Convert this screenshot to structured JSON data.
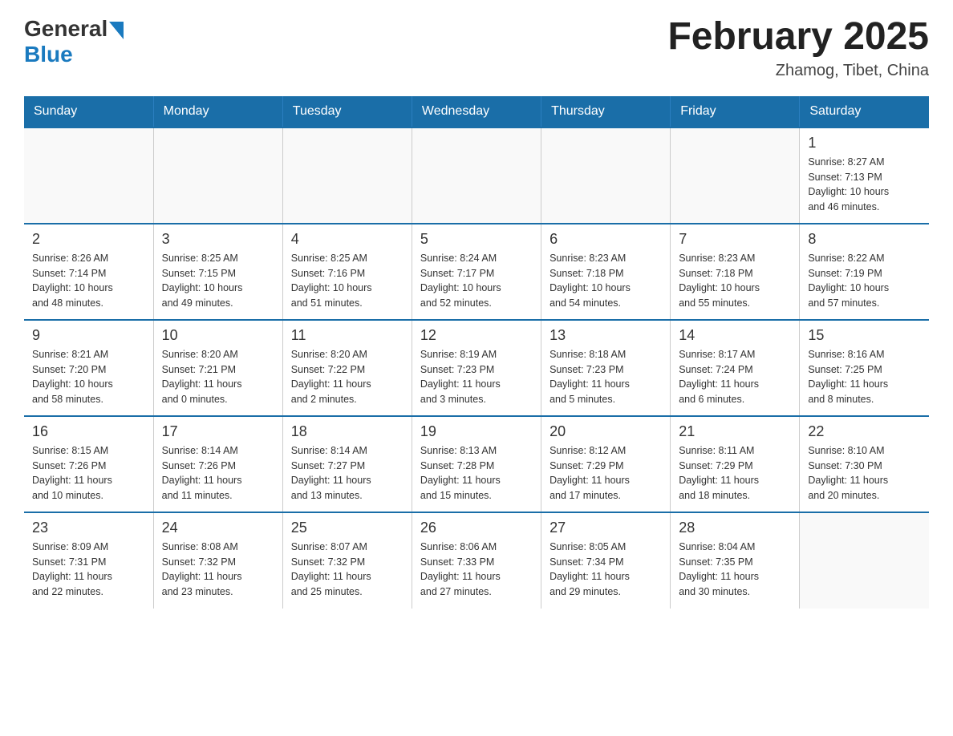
{
  "header": {
    "logo_general": "General",
    "logo_blue": "Blue",
    "month_title": "February 2025",
    "location": "Zhamog, Tibet, China"
  },
  "days_of_week": [
    "Sunday",
    "Monday",
    "Tuesday",
    "Wednesday",
    "Thursday",
    "Friday",
    "Saturday"
  ],
  "weeks": [
    [
      {
        "day": "",
        "info": ""
      },
      {
        "day": "",
        "info": ""
      },
      {
        "day": "",
        "info": ""
      },
      {
        "day": "",
        "info": ""
      },
      {
        "day": "",
        "info": ""
      },
      {
        "day": "",
        "info": ""
      },
      {
        "day": "1",
        "info": "Sunrise: 8:27 AM\nSunset: 7:13 PM\nDaylight: 10 hours\nand 46 minutes."
      }
    ],
    [
      {
        "day": "2",
        "info": "Sunrise: 8:26 AM\nSunset: 7:14 PM\nDaylight: 10 hours\nand 48 minutes."
      },
      {
        "day": "3",
        "info": "Sunrise: 8:25 AM\nSunset: 7:15 PM\nDaylight: 10 hours\nand 49 minutes."
      },
      {
        "day": "4",
        "info": "Sunrise: 8:25 AM\nSunset: 7:16 PM\nDaylight: 10 hours\nand 51 minutes."
      },
      {
        "day": "5",
        "info": "Sunrise: 8:24 AM\nSunset: 7:17 PM\nDaylight: 10 hours\nand 52 minutes."
      },
      {
        "day": "6",
        "info": "Sunrise: 8:23 AM\nSunset: 7:18 PM\nDaylight: 10 hours\nand 54 minutes."
      },
      {
        "day": "7",
        "info": "Sunrise: 8:23 AM\nSunset: 7:18 PM\nDaylight: 10 hours\nand 55 minutes."
      },
      {
        "day": "8",
        "info": "Sunrise: 8:22 AM\nSunset: 7:19 PM\nDaylight: 10 hours\nand 57 minutes."
      }
    ],
    [
      {
        "day": "9",
        "info": "Sunrise: 8:21 AM\nSunset: 7:20 PM\nDaylight: 10 hours\nand 58 minutes."
      },
      {
        "day": "10",
        "info": "Sunrise: 8:20 AM\nSunset: 7:21 PM\nDaylight: 11 hours\nand 0 minutes."
      },
      {
        "day": "11",
        "info": "Sunrise: 8:20 AM\nSunset: 7:22 PM\nDaylight: 11 hours\nand 2 minutes."
      },
      {
        "day": "12",
        "info": "Sunrise: 8:19 AM\nSunset: 7:23 PM\nDaylight: 11 hours\nand 3 minutes."
      },
      {
        "day": "13",
        "info": "Sunrise: 8:18 AM\nSunset: 7:23 PM\nDaylight: 11 hours\nand 5 minutes."
      },
      {
        "day": "14",
        "info": "Sunrise: 8:17 AM\nSunset: 7:24 PM\nDaylight: 11 hours\nand 6 minutes."
      },
      {
        "day": "15",
        "info": "Sunrise: 8:16 AM\nSunset: 7:25 PM\nDaylight: 11 hours\nand 8 minutes."
      }
    ],
    [
      {
        "day": "16",
        "info": "Sunrise: 8:15 AM\nSunset: 7:26 PM\nDaylight: 11 hours\nand 10 minutes."
      },
      {
        "day": "17",
        "info": "Sunrise: 8:14 AM\nSunset: 7:26 PM\nDaylight: 11 hours\nand 11 minutes."
      },
      {
        "day": "18",
        "info": "Sunrise: 8:14 AM\nSunset: 7:27 PM\nDaylight: 11 hours\nand 13 minutes."
      },
      {
        "day": "19",
        "info": "Sunrise: 8:13 AM\nSunset: 7:28 PM\nDaylight: 11 hours\nand 15 minutes."
      },
      {
        "day": "20",
        "info": "Sunrise: 8:12 AM\nSunset: 7:29 PM\nDaylight: 11 hours\nand 17 minutes."
      },
      {
        "day": "21",
        "info": "Sunrise: 8:11 AM\nSunset: 7:29 PM\nDaylight: 11 hours\nand 18 minutes."
      },
      {
        "day": "22",
        "info": "Sunrise: 8:10 AM\nSunset: 7:30 PM\nDaylight: 11 hours\nand 20 minutes."
      }
    ],
    [
      {
        "day": "23",
        "info": "Sunrise: 8:09 AM\nSunset: 7:31 PM\nDaylight: 11 hours\nand 22 minutes."
      },
      {
        "day": "24",
        "info": "Sunrise: 8:08 AM\nSunset: 7:32 PM\nDaylight: 11 hours\nand 23 minutes."
      },
      {
        "day": "25",
        "info": "Sunrise: 8:07 AM\nSunset: 7:32 PM\nDaylight: 11 hours\nand 25 minutes."
      },
      {
        "day": "26",
        "info": "Sunrise: 8:06 AM\nSunset: 7:33 PM\nDaylight: 11 hours\nand 27 minutes."
      },
      {
        "day": "27",
        "info": "Sunrise: 8:05 AM\nSunset: 7:34 PM\nDaylight: 11 hours\nand 29 minutes."
      },
      {
        "day": "28",
        "info": "Sunrise: 8:04 AM\nSunset: 7:35 PM\nDaylight: 11 hours\nand 30 minutes."
      },
      {
        "day": "",
        "info": ""
      }
    ]
  ]
}
